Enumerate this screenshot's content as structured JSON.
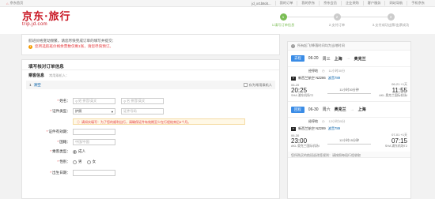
{
  "topbar": {
    "home": "京东首页",
    "user": "jd_xr1b8d4...",
    "links": [
      "我的订单",
      "我的京东",
      "京东会员",
      "企业采购",
      "客户服务",
      "网站导航",
      "手机京东"
    ]
  },
  "brand": {
    "logo": "京东·旅行",
    "sub": "trip.jd.com"
  },
  "steps": [
    {
      "num": "1",
      "label": "1.填写订单信息"
    },
    {
      "num": "2",
      "label": "2.支付订单"
    },
    {
      "num": "3",
      "label": "3.支付成功出票/出票成功"
    }
  ],
  "notice": {
    "line1": "航班价格变动频繁，请您尽快完成订单的填写并提交：",
    "line2": "您所选航班价格余票数仅剩1张，请您尽快预订。"
  },
  "form": {
    "title": "填写核对订单信息",
    "section": "乘客信息",
    "section_sub": "常用乘机人：",
    "pax_num": "1",
    "pax_action": "清空",
    "save_label": "存为常用乘机人",
    "fields": {
      "name_label": "姓名：",
      "surname_ph": "姓 拼音/英文",
      "given_ph": "名 拼音/英文",
      "doc_label": "证件类型：",
      "doc_value": "护照",
      "doc_no_ph": "证件号码",
      "hint": "请如实填写：为了您的顺利出行，请确保证件有效期至少在行程结束后6个月。",
      "validity_label": "证件有效期：",
      "nation_label": "国籍：",
      "nation_ph": "中国/中国",
      "pax_type_label": "乘客类型：",
      "pax_type_value": "成人",
      "gender_label": "性别：",
      "gender_male": "男",
      "gender_female": "女",
      "birth_label": "出生日期："
    }
  },
  "side": {
    "notice": "所有起飞/降落时间均为当地时间",
    "outbound": {
      "tag": "去程",
      "date": "06-20",
      "weekday": "周三",
      "from": "上海",
      "to": "奥克兰",
      "stop_label": "经停地",
      "stop_info": "11小时30分",
      "airline": "新西兰航空 NZ286",
      "plane": "波音789",
      "dep_date": "06-20",
      "arr_date": "06-21 +1天",
      "duration": "11小时30分钟",
      "dep_time": "20:25",
      "arr_time": "11:55",
      "dep_airport": "SHA 浦东机场T2",
      "arr_airport": "AKL 奥克兰国际机场I"
    },
    "return": {
      "tag": "回程",
      "date": "06-30",
      "weekday": "周六",
      "from": "奥克兰",
      "to": "上海",
      "stop_label": "经停地",
      "stop_info": "12小时15分",
      "airline": "新西兰航空 NZ289",
      "plane": "波音789",
      "dep_date": "06-30",
      "arr_date": "07-01 +1天",
      "duration": "12小时15分钟",
      "dep_time": "23:00",
      "arr_time": "07:15",
      "dep_airport": "AKL 奥克兰国际机场I",
      "arr_airport": "SHA 浦东机场T2"
    },
    "policy": "您所购买的航班退改签规则：请按照每段行程收取"
  },
  "colors": {
    "brand": "#c81623",
    "step_active": "#7abd54",
    "tag": "#3a8ce6"
  }
}
